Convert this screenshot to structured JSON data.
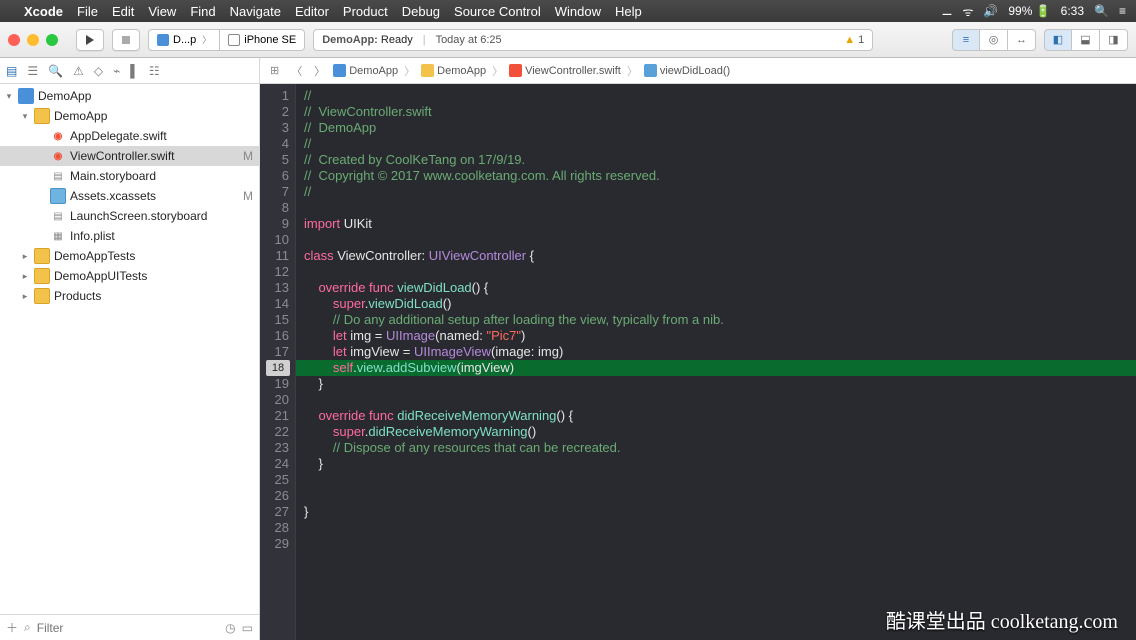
{
  "menubar": {
    "app": "Xcode",
    "items": [
      "File",
      "Edit",
      "View",
      "Find",
      "Navigate",
      "Editor",
      "Product",
      "Debug",
      "Source Control",
      "Window",
      "Help"
    ],
    "battery": "99%",
    "time": "6:33"
  },
  "toolbar": {
    "scheme_app": "D...p",
    "scheme_device": "iPhone SE",
    "activity_app": "DemoApp:",
    "activity_status": "Ready",
    "activity_time": "Today at 6:25",
    "warn_count": "1"
  },
  "jumpbar": {
    "items": [
      "DemoApp",
      "DemoApp",
      "ViewController.swift",
      "viewDidLoad()"
    ]
  },
  "tree": {
    "project": "DemoApp",
    "group": "DemoApp",
    "files": [
      {
        "name": "AppDelegate.swift",
        "icon": "swift"
      },
      {
        "name": "ViewController.swift",
        "icon": "swift",
        "selected": true,
        "modified": "M"
      },
      {
        "name": "Main.storyboard",
        "icon": "sb"
      },
      {
        "name": "Assets.xcassets",
        "icon": "fldb",
        "modified": "M"
      },
      {
        "name": "LaunchScreen.storyboard",
        "icon": "sb"
      },
      {
        "name": "Info.plist",
        "icon": "plist"
      }
    ],
    "groups": [
      "DemoAppTests",
      "DemoAppUITests",
      "Products"
    ]
  },
  "filter": {
    "placeholder": "Filter"
  },
  "code": {
    "highlight_line": 18,
    "highlight_badge": "18",
    "lines": [
      {
        "n": 1,
        "seg": [
          [
            "cm",
            "//"
          ]
        ]
      },
      {
        "n": 2,
        "seg": [
          [
            "cm",
            "//  ViewController.swift"
          ]
        ]
      },
      {
        "n": 3,
        "seg": [
          [
            "cm",
            "//  DemoApp"
          ]
        ]
      },
      {
        "n": 4,
        "seg": [
          [
            "cm",
            "//"
          ]
        ]
      },
      {
        "n": 5,
        "seg": [
          [
            "cm",
            "//  Created by CoolKeTang on 17/9/19."
          ]
        ]
      },
      {
        "n": 6,
        "seg": [
          [
            "cm",
            "//  Copyright © 2017 www.coolketang.com. All rights reserved."
          ]
        ]
      },
      {
        "n": 7,
        "seg": [
          [
            "cm",
            "//"
          ]
        ]
      },
      {
        "n": 8,
        "seg": []
      },
      {
        "n": 9,
        "seg": [
          [
            "kw",
            "import "
          ],
          [
            "id",
            "UIKit"
          ]
        ]
      },
      {
        "n": 10,
        "seg": []
      },
      {
        "n": 11,
        "seg": [
          [
            "kw",
            "class "
          ],
          [
            "id",
            "ViewController: "
          ],
          [
            "tyb",
            "UIViewController"
          ],
          [
            "id",
            " {"
          ]
        ]
      },
      {
        "n": 12,
        "seg": []
      },
      {
        "n": 13,
        "seg": [
          [
            "id",
            "    "
          ],
          [
            "ov",
            "override "
          ],
          [
            "kw",
            "func "
          ],
          [
            "ty",
            "viewDidLoad"
          ],
          [
            "id",
            "() {"
          ]
        ]
      },
      {
        "n": 14,
        "seg": [
          [
            "id",
            "        "
          ],
          [
            "kw",
            "super"
          ],
          [
            "id",
            "."
          ],
          [
            "ty",
            "viewDidLoad"
          ],
          [
            "id",
            "()"
          ]
        ]
      },
      {
        "n": 15,
        "seg": [
          [
            "id",
            "        "
          ],
          [
            "cm",
            "// Do any additional setup after loading the view, typically from a nib."
          ]
        ]
      },
      {
        "n": 16,
        "seg": [
          [
            "id",
            "        "
          ],
          [
            "kw",
            "let"
          ],
          [
            "id",
            " img = "
          ],
          [
            "tyb",
            "UIImage"
          ],
          [
            "id",
            "(named: "
          ],
          [
            "str",
            "\"Pic7\""
          ],
          [
            "id",
            ")"
          ]
        ]
      },
      {
        "n": 17,
        "seg": [
          [
            "id",
            "        "
          ],
          [
            "kw",
            "let"
          ],
          [
            "id",
            " imgView = "
          ],
          [
            "tyb",
            "UIImageView"
          ],
          [
            "id",
            "(image: img)"
          ]
        ]
      },
      {
        "n": 18,
        "seg": [
          [
            "id",
            "        "
          ],
          [
            "self",
            "self"
          ],
          [
            "id",
            "."
          ],
          [
            "ty",
            "view"
          ],
          [
            "id",
            "."
          ],
          [
            "ty",
            "addSubview"
          ],
          [
            "id",
            "(imgView)"
          ]
        ]
      },
      {
        "n": 19,
        "seg": [
          [
            "id",
            "    }"
          ]
        ]
      },
      {
        "n": 20,
        "seg": []
      },
      {
        "n": 21,
        "seg": [
          [
            "id",
            "    "
          ],
          [
            "ov",
            "override "
          ],
          [
            "kw",
            "func "
          ],
          [
            "ty",
            "didReceiveMemoryWarning"
          ],
          [
            "id",
            "() {"
          ]
        ]
      },
      {
        "n": 22,
        "seg": [
          [
            "id",
            "        "
          ],
          [
            "kw",
            "super"
          ],
          [
            "id",
            "."
          ],
          [
            "ty",
            "didReceiveMemoryWarning"
          ],
          [
            "id",
            "()"
          ]
        ]
      },
      {
        "n": 23,
        "seg": [
          [
            "id",
            "        "
          ],
          [
            "cm",
            "// Dispose of any resources that can be recreated."
          ]
        ]
      },
      {
        "n": 24,
        "seg": [
          [
            "id",
            "    }"
          ]
        ]
      },
      {
        "n": 25,
        "seg": []
      },
      {
        "n": 26,
        "seg": []
      },
      {
        "n": 27,
        "seg": [
          [
            "id",
            "}"
          ]
        ]
      },
      {
        "n": 28,
        "seg": []
      },
      {
        "n": 29,
        "seg": []
      }
    ]
  },
  "watermark": "酷课堂出品 coolketang.com"
}
